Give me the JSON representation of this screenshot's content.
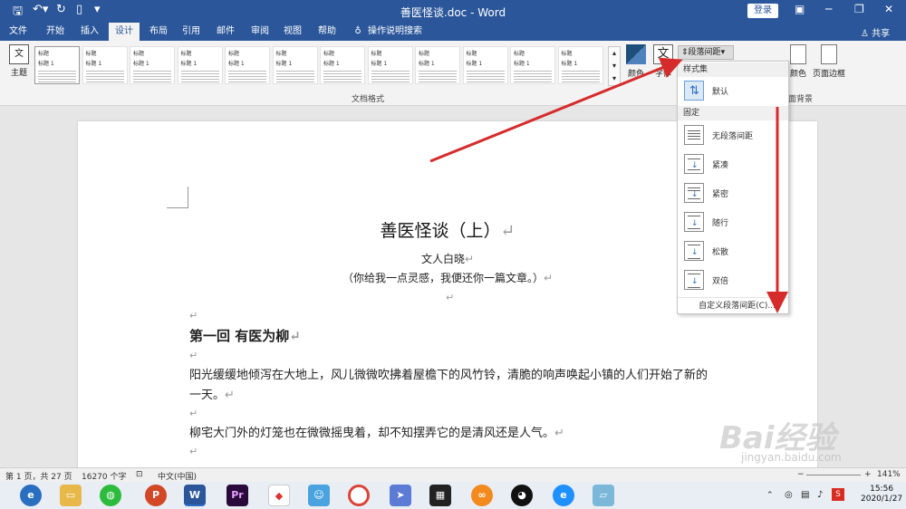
{
  "window": {
    "title": "善医怪谈.doc - Word",
    "login_label": "登录",
    "share_label": "共享"
  },
  "tabs": [
    {
      "label": "文件",
      "active": false
    },
    {
      "label": "开始",
      "active": false
    },
    {
      "label": "插入",
      "active": false
    },
    {
      "label": "设计",
      "active": true
    },
    {
      "label": "布局",
      "active": false
    },
    {
      "label": "引用",
      "active": false
    },
    {
      "label": "邮件",
      "active": false
    },
    {
      "label": "审阅",
      "active": false
    },
    {
      "label": "视图",
      "active": false
    },
    {
      "label": "帮助",
      "active": false
    },
    {
      "label": "操作说明搜索",
      "active": false
    }
  ],
  "ribbon": {
    "theme_label": "主题",
    "theme_icon_text": "文",
    "gallery_label": "文档格式",
    "color_label": "颜色",
    "font_label": "字体",
    "font_icon_text": "文",
    "paragraph_spacing_label": "段落间距",
    "page_color_label": "颜色",
    "page_border_label": "页面边框",
    "background_group_label": "面背景",
    "style_thumbs": [
      {
        "title": "标题",
        "sub": "标题 1"
      },
      {
        "title": "标题",
        "sub": "标题 1"
      },
      {
        "title": "标题",
        "sub": "标题 1"
      },
      {
        "title": "标题",
        "sub": "标题 1"
      },
      {
        "title": "标题",
        "sub": "标题 1"
      },
      {
        "title": "标题",
        "sub": "标题 1"
      },
      {
        "title": "标题",
        "sub": "标题 1"
      },
      {
        "title": "标题",
        "sub": "标题 1"
      },
      {
        "title": "标题",
        "sub": "标题 1"
      },
      {
        "title": "标题",
        "sub": "标题 1"
      },
      {
        "title": "标题",
        "sub": "标题 1"
      },
      {
        "title": "标题",
        "sub": "标题 1"
      }
    ]
  },
  "dropdown": {
    "header_builtin": "样式集",
    "header_fixed": "固定",
    "default_label": "默认",
    "items": [
      "无段落间距",
      "紧凑",
      "紧密",
      "随行",
      "松散",
      "双倍"
    ],
    "custom_label": "自定义段落间距(C)..."
  },
  "document": {
    "title": "善医怪谈（上）",
    "author": "文人白晓",
    "subtitle": "（你给我一点灵感，我便还你一篇文章。）",
    "chapter": "第一回  有医为柳",
    "para1": "阳光缓缓地倾泻在大地上，风儿微微吹拂着屋檐下的风竹铃，清脆的响声唤起小镇的人们开始了新的一天。",
    "para2": "柳宅大门外的灯笼也在微微摇曳着，却不知摆弄它的是清风还是人气。",
    "paragraph_mark": "↵"
  },
  "status": {
    "page": "第 1 页，共 27 页",
    "words": "16270 个字",
    "language": "中文(中国)",
    "zoom": "141%"
  },
  "taskbar": {
    "time": "15:56",
    "date": "2020/1/27"
  },
  "watermark": {
    "text": "Bai经验",
    "url": "jingyan.baidu.com"
  },
  "colors": {
    "accent": "#2b579a",
    "arrow": "#d62b2b"
  }
}
